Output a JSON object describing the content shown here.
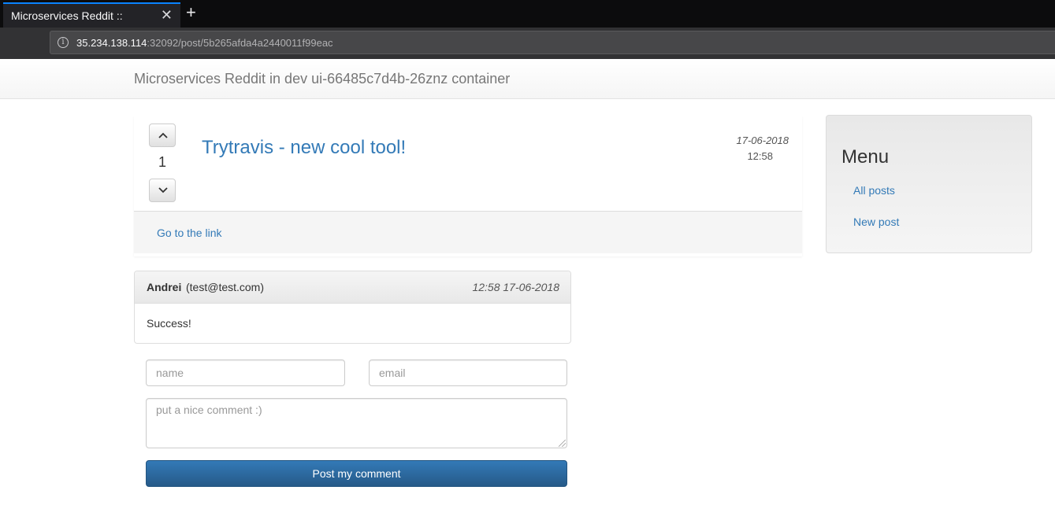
{
  "browser": {
    "tab_title": "Microservices Reddit ::",
    "close_glyph": "✕",
    "newtab_glyph": "+",
    "url_host": "35.234.138.114",
    "url_rest": ":32092/post/5b265afda4a2440011f99eac",
    "info_glyph": "i"
  },
  "header": {
    "brand": "Microservices Reddit in dev ui-66485c7d4b-26znz container"
  },
  "post": {
    "votes": "1",
    "title": "Trytravis - new cool tool!",
    "date": "17-06-2018",
    "time": "12:58",
    "link_label": "Go to the link"
  },
  "sidebar": {
    "title": "Menu",
    "items": [
      {
        "label": "All posts"
      },
      {
        "label": "New post"
      }
    ]
  },
  "comment": {
    "author": "Andrei",
    "email": "(test@test.com)",
    "date": "12:58 17-06-2018",
    "body": "Success!"
  },
  "form": {
    "name_placeholder": "name",
    "email_placeholder": "email",
    "comment_placeholder": "put a nice comment :)",
    "submit_label": "Post my comment"
  },
  "colors": {
    "link": "#337ab7",
    "primary_button": "#337ab7",
    "tab_accent": "#0a84ff"
  },
  "icons": [
    "info-icon",
    "close-icon",
    "plus-icon",
    "chevron-up-icon",
    "chevron-down-icon"
  ]
}
